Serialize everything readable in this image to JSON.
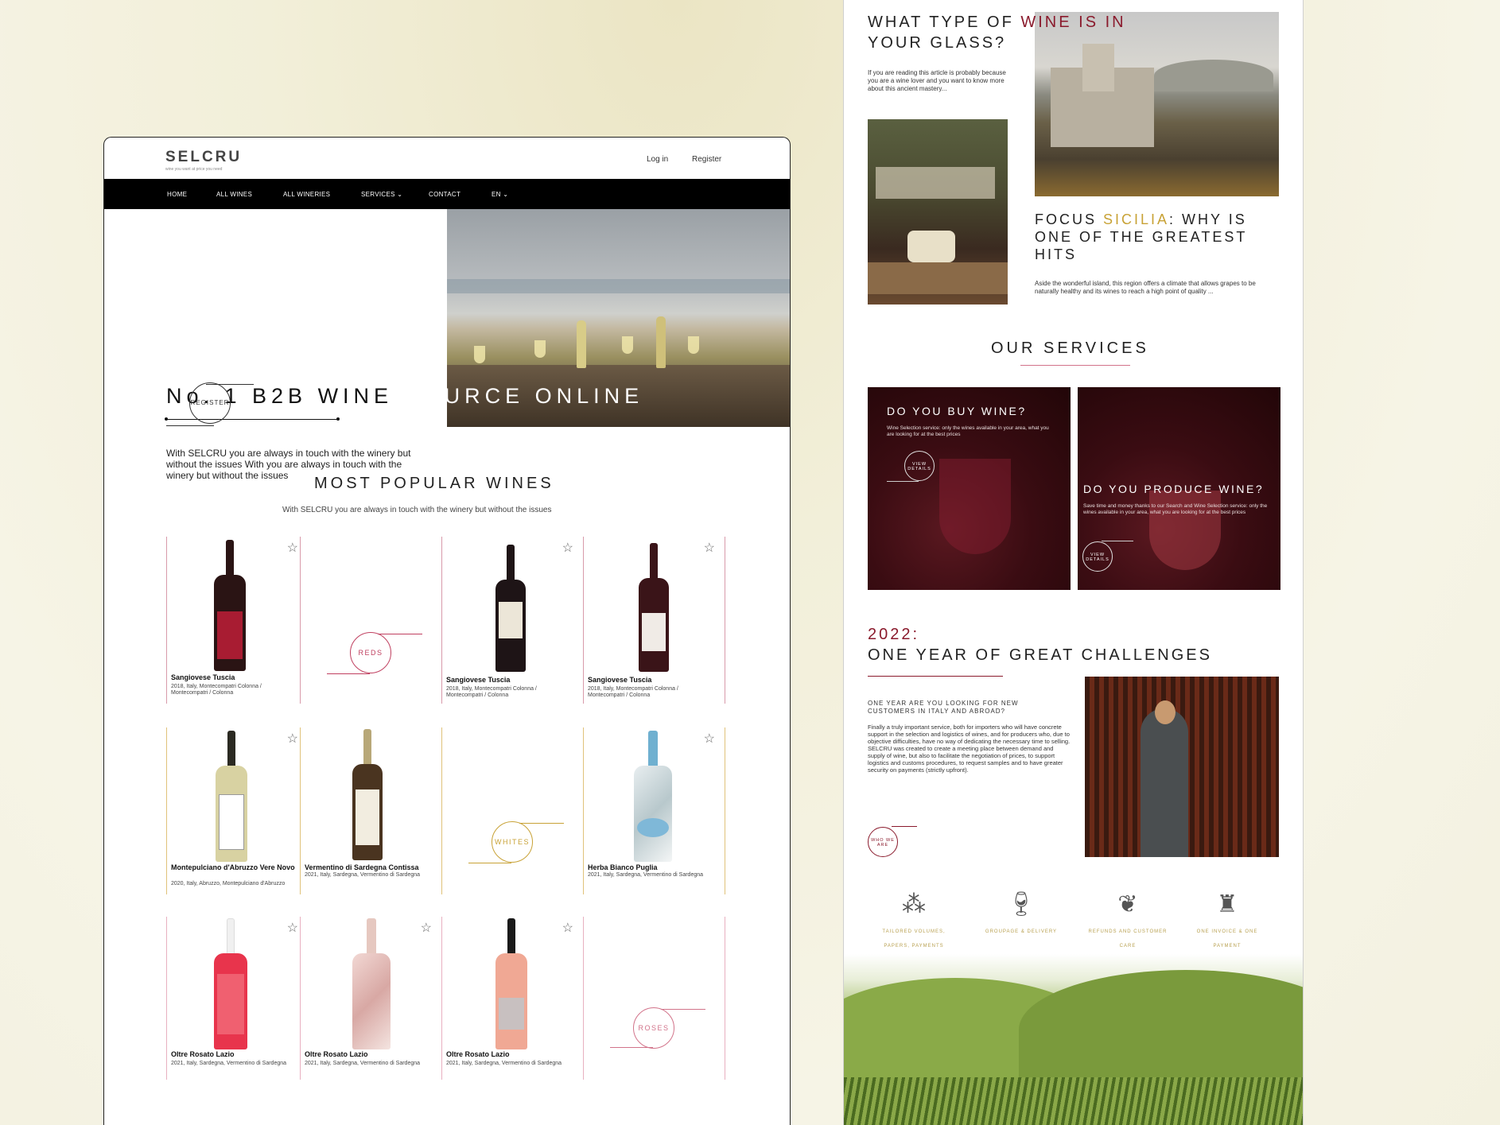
{
  "left": {
    "logo": {
      "name": "SELCRU",
      "tagline": "wine you want at price you need"
    },
    "header_links": {
      "login": "Log in",
      "register": "Register"
    },
    "nav": [
      "HOME",
      "ALL WINES",
      "ALL WINERIES",
      "SERVICES ⌄",
      "CONTACT",
      "EN ⌄"
    ],
    "hero": {
      "title_dark": "No. 1 B2B WINE ",
      "title_light": "SOURCE ONLINE",
      "text": "With SELCRU you are always in touch with the winery but without the issues With you are always in touch with the winery but without the issues",
      "register_btn": "REGISTER"
    },
    "popular": {
      "title": "MOST POPULAR WINES",
      "subtitle": "With SELCRU you are always in touch with the winery but without the issues",
      "categories": {
        "reds": "REDS",
        "whites": "WHITES",
        "roses": "ROSES"
      },
      "wines": [
        {
          "name": "Sangiovese Tuscia",
          "meta": "2018, Italy, Montecompatri Colonna / Montecompatri / Colonna"
        },
        {
          "name": "Sangiovese Tuscia",
          "meta": "2018, Italy, Montecompatri Colonna / Montecompatri / Colonna"
        },
        {
          "name": "Sangiovese Tuscia",
          "meta": "2018, Italy, Montecompatri Colonna / Montecompatri / Colonna"
        },
        {
          "name": "Montepulciano d'Abruzzo Vere Novo",
          "meta": "2020, Italy, Abruzzo, Montepulciano d'Abruzzo"
        },
        {
          "name": "Vermentino di Sardegna Contissa",
          "meta": "2021, Italy, Sardegna, Vermentino di Sardegna"
        },
        {
          "name": "Herba Bianco Puglia",
          "meta": "2021, Italy, Sardegna, Vermentino di Sardegna"
        },
        {
          "name": "Oltre Rosato Lazio",
          "meta": "2021, Italy, Sardegna, Vermentino di Sardegna"
        },
        {
          "name": "Oltre Rosato Lazio",
          "meta": "2021, Italy, Sardegna, Vermentino di Sardegna"
        },
        {
          "name": "Oltre Rosato Lazio",
          "meta": "2021, Italy, Sardegna, Vermentino di Sardegna"
        }
      ]
    }
  },
  "right": {
    "article1": {
      "title_dark": "WHAT TYPE OF ",
      "title_accent": "WINE IS IN",
      "title_line2": "YOUR GLASS?",
      "text": "If you are reading this article is probably because you are a wine lover and you want to know more about this ancient mastery..."
    },
    "article2": {
      "title_pre": "FOCUS ",
      "title_accent": "SICILIA",
      "title_post": ": WHY IS ONE OF THE GREATEST HITS",
      "text": "Aside the wonderful island, this region offers a climate that allows grapes to be naturally healthy and its wines to reach a high point of quality ..."
    },
    "services": {
      "title": "OUR SERVICES",
      "buy": {
        "title": "DO YOU BUY WINE?",
        "text": "Wine Selection service: only the wines available in your area, what you are looking for at the best prices",
        "btn": "VIEW DETAILS"
      },
      "produce": {
        "title": "DO YOU PRODUCE WINE?",
        "text": "Save time and money thanks to our Search and Wine Selection service: only the wines available in your area, what you are looking for at the best prices",
        "btn": "VIEW DETAILS"
      }
    },
    "year": {
      "year": "2022:",
      "title": "ONE YEAR OF GREAT CHALLENGES",
      "subtitle": "ONE YEAR ARE YOU LOOKING FOR NEW CUSTOMERS IN ITALY AND ABROAD?",
      "text": "Finally a truly important service, both for importers who will have concrete support in the selection and logistics of wines, and for producers who, due to objective difficulties, have no way of dedicating the necessary time to selling. SELCRU was created to create a meeting place between demand and supply of wine, but also to facilitate the negotiation of prices, to support logistics and customs procedures, to request samples and to have greater security on payments (strictly upfront).",
      "btn": "WHO WE ARE"
    },
    "features": [
      {
        "icon": "grapes-icon",
        "label": "TAILORED VOLUMES, PAPERS, PAYMENTS"
      },
      {
        "icon": "wine-glass-icon",
        "label": "GROUPAGE & DELIVERY"
      },
      {
        "icon": "vine-leaf-icon",
        "label": "REFUNDS AND CUSTOMER CARE"
      },
      {
        "icon": "bottle-icon",
        "label": "ONE INVOICE & ONE PAYMENT"
      }
    ]
  },
  "colors": {
    "accent_wine": "#8a1a2c",
    "accent_gold": "#c8a236",
    "rose": "#d2738a",
    "nav_bg": "#000000"
  }
}
